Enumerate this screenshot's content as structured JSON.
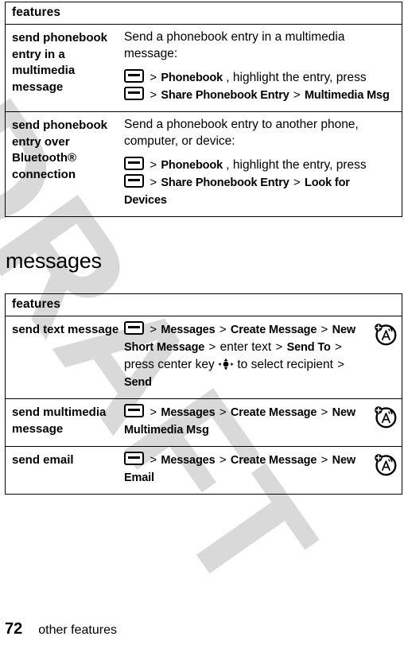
{
  "document": {
    "watermark": "DRAFT",
    "page_number": "72",
    "footer_label": "other features"
  },
  "icons": {
    "menu_key": "menu-key-icon",
    "center_key": "center-navigation-key-icon",
    "text_entry": "text-entry-mode-icon"
  },
  "sections": [
    {
      "id": "other-features-continued",
      "heading": "",
      "table": {
        "header": "features",
        "rows": [
          {
            "feature": "send phonebook entry in a multimedia message",
            "lead": "Send a phonebook entry in a multimedia message:",
            "has_icon": false,
            "steps": [
              {
                "parts": [
                  {
                    "type": "menukey"
                  },
                  {
                    "type": "sep",
                    "text": ">"
                  },
                  {
                    "type": "menu",
                    "text": "Phonebook"
                  },
                  {
                    "type": "plain",
                    "text": ", highlight the entry, press"
                  }
                ]
              },
              {
                "parts": [
                  {
                    "type": "menukey"
                  },
                  {
                    "type": "sep",
                    "text": ">"
                  },
                  {
                    "type": "menu",
                    "text": "Share Phonebook Entry"
                  },
                  {
                    "type": "sep",
                    "text": ">"
                  },
                  {
                    "type": "menu",
                    "text": "Multimedia Msg"
                  }
                ]
              }
            ]
          },
          {
            "feature": "send phonebook entry over Bluetooth® connection",
            "lead": "Send a phonebook entry to another phone, computer, or device:",
            "has_icon": false,
            "steps": [
              {
                "parts": [
                  {
                    "type": "menukey"
                  },
                  {
                    "type": "sep",
                    "text": ">"
                  },
                  {
                    "type": "menu",
                    "text": "Phonebook"
                  },
                  {
                    "type": "plain",
                    "text": ", highlight the entry, press"
                  }
                ]
              },
              {
                "parts": [
                  {
                    "type": "menukey"
                  },
                  {
                    "type": "sep",
                    "text": ">"
                  },
                  {
                    "type": "menu",
                    "text": "Share Phonebook Entry"
                  },
                  {
                    "type": "sep",
                    "text": ">"
                  },
                  {
                    "type": "menu",
                    "text": "Look for Devices"
                  }
                ]
              }
            ]
          }
        ]
      }
    },
    {
      "id": "messages",
      "heading": "messages",
      "table": {
        "header": "features",
        "rows": [
          {
            "feature": "send text message",
            "lead": "",
            "has_icon": true,
            "steps": [
              {
                "parts": [
                  {
                    "type": "menukey"
                  },
                  {
                    "type": "sep",
                    "text": ">"
                  },
                  {
                    "type": "menu",
                    "text": "Messages"
                  },
                  {
                    "type": "sep",
                    "text": ">"
                  },
                  {
                    "type": "menu",
                    "text": "Create Message"
                  },
                  {
                    "type": "sep",
                    "text": ">"
                  },
                  {
                    "type": "menu",
                    "text": "New Short Message"
                  },
                  {
                    "type": "sep",
                    "text": ">"
                  },
                  {
                    "type": "plain",
                    "text": "enter text"
                  },
                  {
                    "type": "sep",
                    "text": ">"
                  },
                  {
                    "type": "menu",
                    "text": "Send To"
                  },
                  {
                    "type": "sep",
                    "text": ">"
                  },
                  {
                    "type": "plain",
                    "text": "press center key"
                  },
                  {
                    "type": "navkey"
                  },
                  {
                    "type": "plain",
                    "text": "to select recipient"
                  },
                  {
                    "type": "sep",
                    "text": ">"
                  },
                  {
                    "type": "menu",
                    "text": "Send"
                  }
                ]
              }
            ]
          },
          {
            "feature": "send multimedia message",
            "lead": "",
            "has_icon": true,
            "steps": [
              {
                "parts": [
                  {
                    "type": "menukey"
                  },
                  {
                    "type": "sep",
                    "text": ">"
                  },
                  {
                    "type": "menu",
                    "text": "Messages"
                  },
                  {
                    "type": "sep",
                    "text": ">"
                  },
                  {
                    "type": "menu",
                    "text": "Create Message"
                  },
                  {
                    "type": "sep",
                    "text": ">"
                  },
                  {
                    "type": "menu",
                    "text": "New Multimedia Msg"
                  }
                ]
              }
            ]
          },
          {
            "feature": "send email",
            "lead": "",
            "has_icon": true,
            "steps": [
              {
                "parts": [
                  {
                    "type": "menukey"
                  },
                  {
                    "type": "sep",
                    "text": ">"
                  },
                  {
                    "type": "menu",
                    "text": "Messages"
                  },
                  {
                    "type": "sep",
                    "text": ">"
                  },
                  {
                    "type": "menu",
                    "text": "Create Message"
                  },
                  {
                    "type": "sep",
                    "text": ">"
                  },
                  {
                    "type": "menu",
                    "text": "New Email"
                  }
                ]
              }
            ]
          }
        ]
      }
    }
  ],
  "colors": {
    "ink": "#000000",
    "paper": "#ffffff",
    "watermark": "#d9d9d9"
  }
}
